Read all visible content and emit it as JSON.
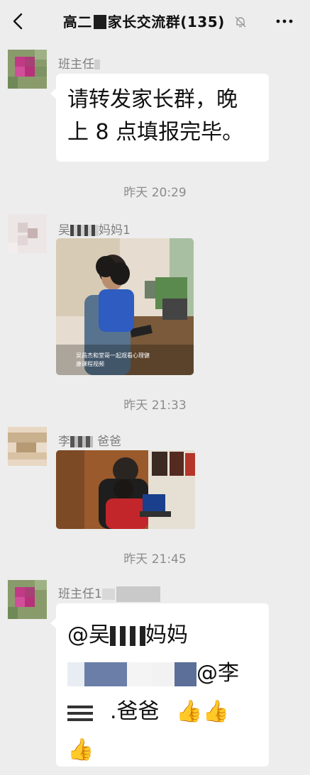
{
  "header": {
    "title_prefix": "高二",
    "title_suffix": "家长交流群(135)"
  },
  "messages": [
    {
      "sender": "班主任",
      "text_line1": "请转发家长群，晚",
      "text_line2": "上 8 点填报完毕。"
    },
    {
      "time": "昨天 20:29"
    },
    {
      "sender": "吴",
      "sender_suffix": "妈妈1",
      "photo_caption_line1": "吴昌杰和堂哥一起观看心理健",
      "photo_caption_line2": "康课程视频"
    },
    {
      "time": "昨天 21:33"
    },
    {
      "sender": "李",
      "sender_suffix": "爸爸"
    },
    {
      "time": "昨天 21:45"
    },
    {
      "sender": "班主任1",
      "mention1_prefix": "@吴",
      "mention1_suffix": "妈妈",
      "mention2_prefix": "@李",
      "mention2_suffix": ".爸爸",
      "emoji": "👍"
    }
  ],
  "colors": {
    "background": "#ededed",
    "bubble": "#ffffff",
    "meta_text": "#8c8c8c"
  },
  "icons": [
    "back-arrow-icon",
    "mute-bell-icon",
    "more-dots-icon",
    "thumbs-up-icon"
  ]
}
